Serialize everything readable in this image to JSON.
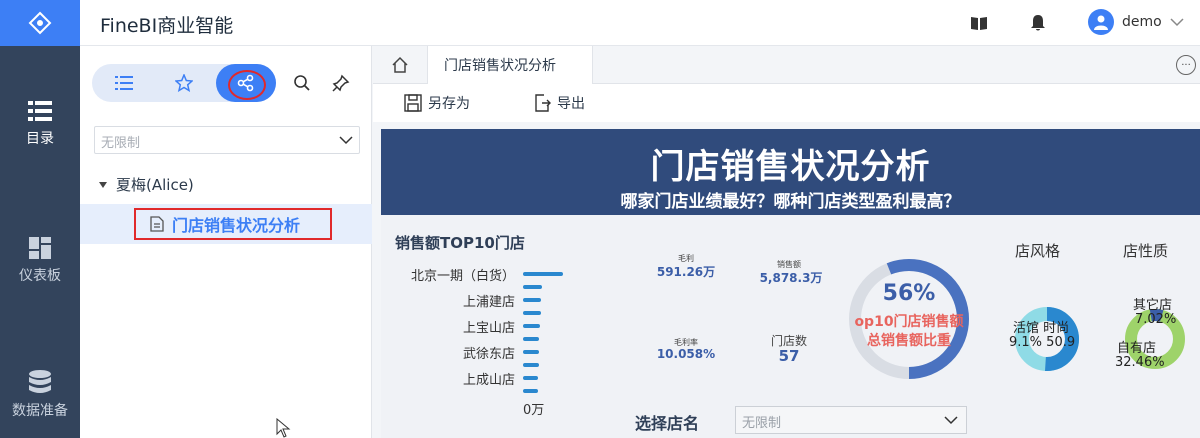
{
  "app": {
    "title": "FineBI商业智能"
  },
  "nav": {
    "items": [
      {
        "label": "目录",
        "icon": "list-icon",
        "active": true
      },
      {
        "label": "仪表板",
        "icon": "dashboard-icon",
        "active": false
      },
      {
        "label": "数据准备",
        "icon": "database-icon",
        "active": false
      }
    ]
  },
  "header": {
    "user_name": "demo"
  },
  "sidebar": {
    "filter_value": "无限制",
    "folder_label": "夏梅(Alice)",
    "item_label": "门店销售状况分析"
  },
  "tabs": {
    "active_tab": "门店销售状况分析"
  },
  "toolbar": {
    "save_as": "另存为",
    "export": "导出"
  },
  "dashboard": {
    "title": "门店销售状况分析",
    "subtitle": "哪家门店业绩最好？哪种门店类型盈利最高？",
    "top10_title": "销售额TOP10门店",
    "axis_zero": "0万",
    "kpis": {
      "profit_label": "毛利",
      "profit_value": "591.26万",
      "sales_label": "销售额",
      "sales_value": "5,878.3万",
      "margin_label": "毛利率",
      "margin_value": "10.058%",
      "stores_label": "门店数",
      "stores_value": "57"
    },
    "gauge": {
      "percent": "56%",
      "line1": "op10门店销售额",
      "line2": "总销售额比重",
      "fraction": 0.56
    },
    "style_title": "店风格",
    "style_donut": {
      "left_label": "活馆",
      "left_pct": "9.1%",
      "right_label": "时尚",
      "right_pct": "50.9"
    },
    "nature_title": "店性质",
    "nature_donut": {
      "top_label": "其它店",
      "top_pct": "7.02%",
      "bottom_label": "自有店",
      "bottom_pct": "32.46%"
    },
    "select_label": "选择店名",
    "select_value": "无限制"
  },
  "chart_data": {
    "type": "bar",
    "title": "销售额TOP10门店",
    "categories": [
      "北京一期（白货）",
      "上浦建店",
      "上宝山店",
      "武徐东店",
      "上成山店"
    ],
    "values": [
      100,
      48,
      46,
      44,
      42
    ],
    "xlabel": "",
    "ylabel": "",
    "tick_labels": [
      "0万"
    ]
  },
  "colors": {
    "accent": "#3d7ff5",
    "rail": "#33445c",
    "banner": "#304b7c",
    "bar": "#2a88cf",
    "highlight": "#e0292b"
  }
}
